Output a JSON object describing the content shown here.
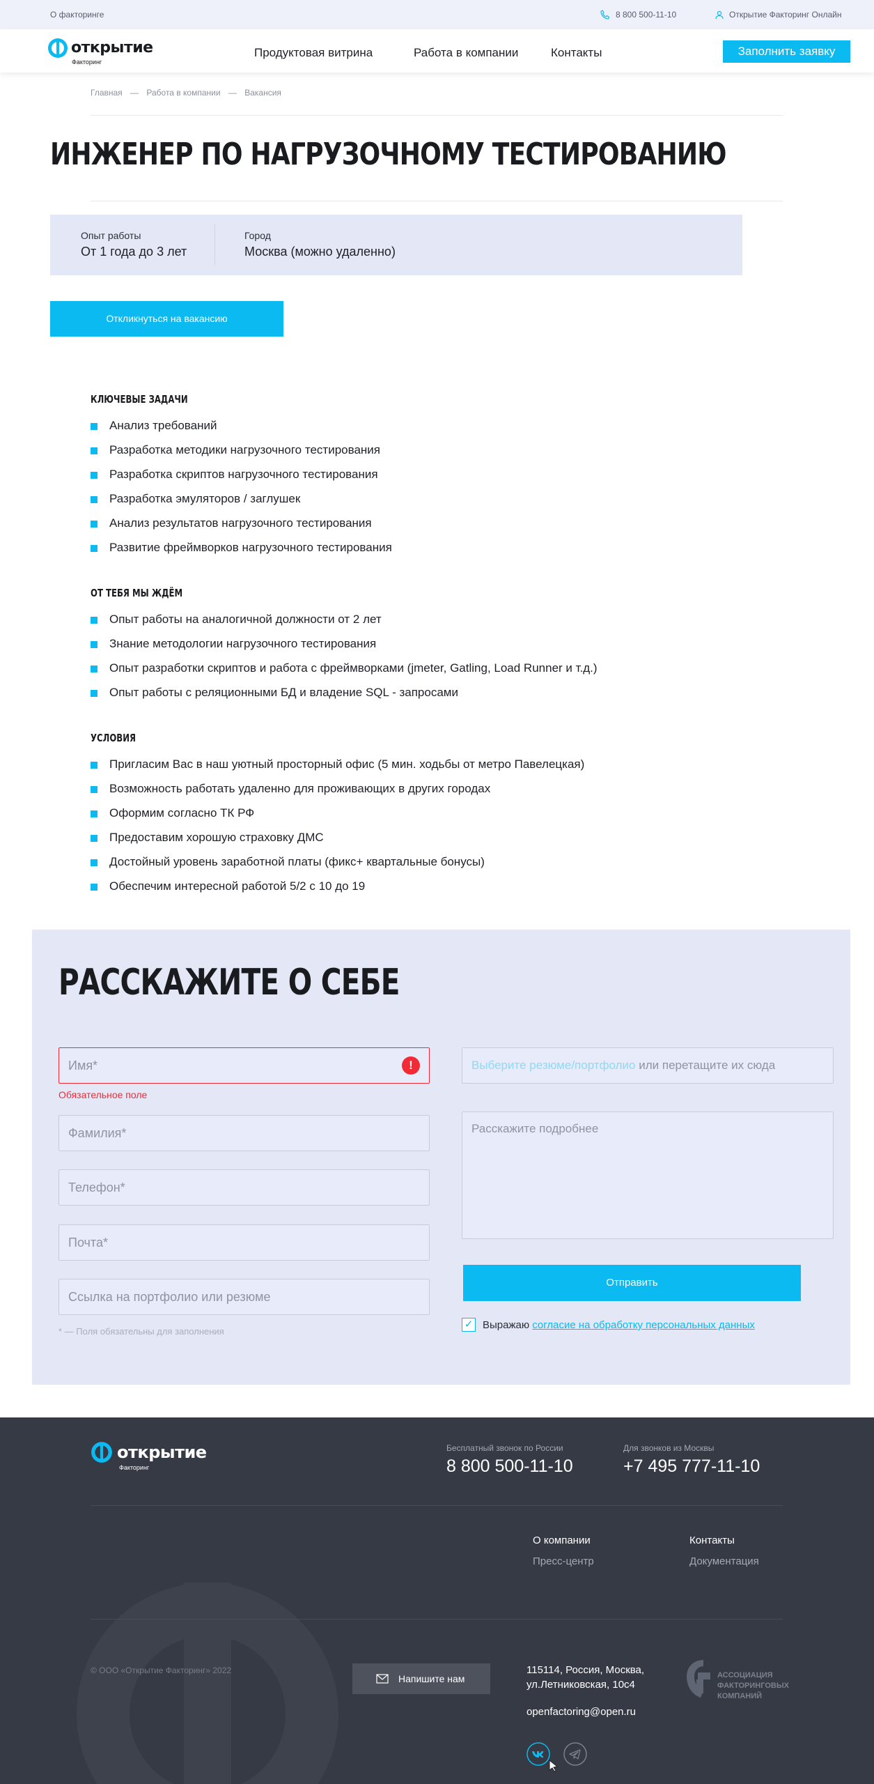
{
  "topbar": {
    "about": "О факторинге",
    "phone": "8 800 500-11-10",
    "online": "Открытие Факторинг Онлайн"
  },
  "header": {
    "logo_text": "открытие",
    "logo_sub": "Факторинг",
    "nav": [
      "Продуктовая витрина",
      "Работа в компании",
      "Контакты"
    ],
    "apply_button": "Заполнить заявку"
  },
  "breadcrumbs": [
    "Главная",
    "—",
    "Работа в компании",
    "—",
    "Вакансия"
  ],
  "vacancy": {
    "title": "ИНЖЕНЕР ПО НАГРУЗОЧНОМУ ТЕСТИРОВАНИЮ",
    "experience_label": "Опыт работы",
    "experience_value": "От 1 года до 3 лет",
    "city_label": "Город",
    "city_value": "Москва (можно удаленно)",
    "respond_button": "Откликнуться на вакансию"
  },
  "sections": [
    {
      "title": "КЛЮЧЕВЫЕ ЗАДАЧИ",
      "items": [
        "Анализ требований",
        "Разработка методики нагрузочного тестирования",
        "Разработка скриптов нагрузочного тестирования",
        "Разработка эмуляторов / заглушек",
        "Анализ результатов нагрузочного тестирования",
        "Развитие фреймворков нагрузочного тестирования"
      ]
    },
    {
      "title": "ОТ ТЕБЯ МЫ ЖДЁМ",
      "items": [
        "Опыт работы на аналогичной должности от 2 лет",
        "Знание методологии нагрузочного тестирования",
        "Опыт разработки скриптов и работа с фреймворками (jmeter, Gatling, Load Runner и т.д.)",
        "Опыт работы с реляционными БД и владение SQL - запросами"
      ]
    },
    {
      "title": "УСЛОВИЯ",
      "items": [
        "Пригласим Вас в наш уютный просторный офис (5 мин. ходьбы от метро Павелецкая)",
        "Возможность работать удаленно для проживающих в других городах",
        "Оформим согласно ТК РФ",
        "Предоставим хорошую страховку ДМС",
        "Достойный уровень заработной платы (фикс+ квартальные бонусы)",
        "Обеспечим интересной работой 5/2 с 10 до 19"
      ]
    }
  ],
  "form": {
    "title": "РАССКАЖИТЕ О СЕБЕ",
    "name_placeholder": "Имя*",
    "name_error": "Обязательное поле",
    "surname_placeholder": "Фамилия*",
    "phone_placeholder": "Телефон*",
    "email_placeholder": "Почта*",
    "link_placeholder": "Ссылка на портфолио или резюме",
    "required_note": "* — Поля обязательны для заполнения",
    "upload_link": "Выберите резюме/портфолио",
    "upload_rest": " или перетащите их сюда",
    "message_placeholder": "Расскажите подробнее",
    "send_button": "Отправить",
    "consent_prefix": "Выражаю ",
    "consent_link": "согласие на обработку персональных данных",
    "consent_checked": true
  },
  "footer": {
    "logo_text": "открытие",
    "logo_sub": "Факторинг",
    "free_call_label": "Бесплатный звонок по России",
    "free_call_phone": "8 800 500-11-10",
    "moscow_label": "Для звонков из Москвы",
    "moscow_phone": "+7 495 777-11-10",
    "links": [
      "О компании",
      "Пресс-центр",
      "Контакты",
      "Документация"
    ],
    "copyright": "© ООО «Открытие Факторинг» 2022",
    "write_button": "Напишите нам",
    "address_line1": "115114, Россия, Москва,",
    "address_line2": "ул.Летниковская, 10с4",
    "email": "openfactoring@open.ru",
    "association": [
      "АССОЦИАЦИЯ",
      "ФАКТОРИНГОВЫХ",
      "КОМПАНИЙ"
    ]
  },
  "colors": {
    "accent": "#0abaf0",
    "error": "#f22a36",
    "form_bg": "#e3e7f6",
    "footer_bg": "#353a45"
  }
}
